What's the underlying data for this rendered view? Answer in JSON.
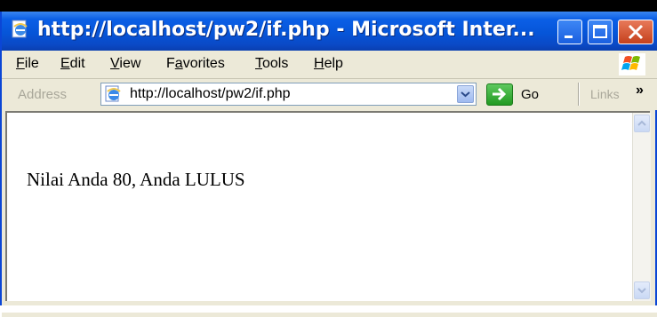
{
  "window": {
    "title": "http://localhost/pw2/if.php - Microsoft Inter..."
  },
  "menu": {
    "items": [
      {
        "label": "File",
        "accel": "F",
        "rest": "ile"
      },
      {
        "label": "Edit",
        "accel": "E",
        "rest": "dit"
      },
      {
        "label": "View",
        "accel": "V",
        "rest": "iew"
      },
      {
        "label": "Favorites",
        "pre": "F",
        "accel": "a",
        "rest": "vorites"
      },
      {
        "label": "Tools",
        "accel": "T",
        "rest": "ools"
      },
      {
        "label": "Help",
        "accel": "H",
        "rest": "elp"
      }
    ]
  },
  "addressbar": {
    "label": "Address",
    "url": "http://localhost/pw2/if.php",
    "go_label": "Go",
    "links_label": "Links",
    "chevron": "»"
  },
  "page": {
    "text": "Nilai Anda 80, Anda LULUS"
  },
  "icons": {
    "title_icon": "ie-page-icon",
    "address_icon": "ie-page-icon",
    "logo": "windows-logo-icon"
  }
}
